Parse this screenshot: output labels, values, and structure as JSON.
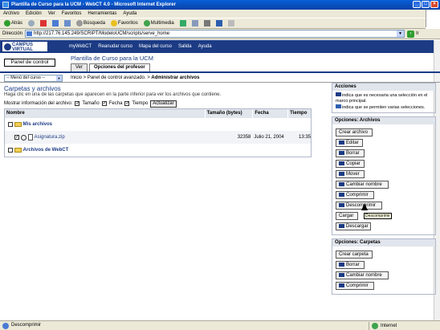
{
  "window": {
    "title": "Plantilla de Curso para la UCM - WebCT 4.0 - Microsoft Internet Explorer"
  },
  "menubar": [
    "Archivo",
    "Edición",
    "Ver",
    "Favoritos",
    "Herramientas",
    "Ayuda"
  ],
  "toolbar": {
    "back": "Atrás",
    "search": "Búsqueda",
    "favorites": "Favoritos",
    "multimedia": "Multimedia"
  },
  "address": {
    "label": "Dirección",
    "url": "http://217.76.145.249/SCRIPT/ModeloUCM/scripts/serve_home",
    "go": "Ir"
  },
  "logo": {
    "line1": "CAMPUS",
    "line2": "VIRTUAL"
  },
  "nav": [
    "myWebCT",
    "Reanudar curso",
    "Mapa del curso",
    "Salida",
    "Ayuda"
  ],
  "control_panel_button": "Panel de control",
  "course_title": "Plantilla de Curso para la UCM",
  "tabs": [
    "Ver",
    "Opciones del profesor"
  ],
  "course_menu_select": "-- Menú del curso --",
  "breadcrumb": {
    "path": "Inicio > Panel de control avanzado. > ",
    "current": "Administrar archivos"
  },
  "page": {
    "title": "Carpetas y archivos",
    "help": "Haga clic en una de las carpetas que aparecen en la parte inferior para ver los archivos que contiene.",
    "show_label": "Mostrar información del archivo:",
    "opts": [
      "Tamaño",
      "Fecha",
      "Tiempo"
    ],
    "update": "Actualizar"
  },
  "table": {
    "headers": [
      "Nombre",
      "Tamaño (bytes)",
      "Fecha",
      "Tiempo"
    ],
    "rows": [
      {
        "name": "Mis archivos",
        "size": "",
        "date": "",
        "time": ""
      },
      {
        "name": "Asignatura.zip",
        "size": "32358",
        "date": "Julio 21, 2004",
        "time": "13:35"
      },
      {
        "name": "Archivos de WebCT",
        "size": "",
        "date": "",
        "time": ""
      }
    ]
  },
  "actions": {
    "title": "Acciones",
    "legend1": "indica que es necesaria una selección en el marco principal.",
    "legend2": "indica que se permiten varias selecciones."
  },
  "file_options": {
    "title": "Opciones: Archivos",
    "create": "Crear archivo",
    "buttons": [
      "Editar",
      "Borrar",
      "Copiar",
      "Mover",
      "Cambiar nombre",
      "Comprimir",
      "Descomprimir"
    ],
    "upload": "Cargar",
    "download": "Descargar"
  },
  "folder_options": {
    "title": "Opciones: Carpetas",
    "create": "Crear carpeta",
    "buttons": [
      "Borrar",
      "Cambiar nombre",
      "Comprimir"
    ]
  },
  "tooltip": "Descomprimir",
  "status": {
    "text": "Descomprimir",
    "zone": "Internet"
  }
}
